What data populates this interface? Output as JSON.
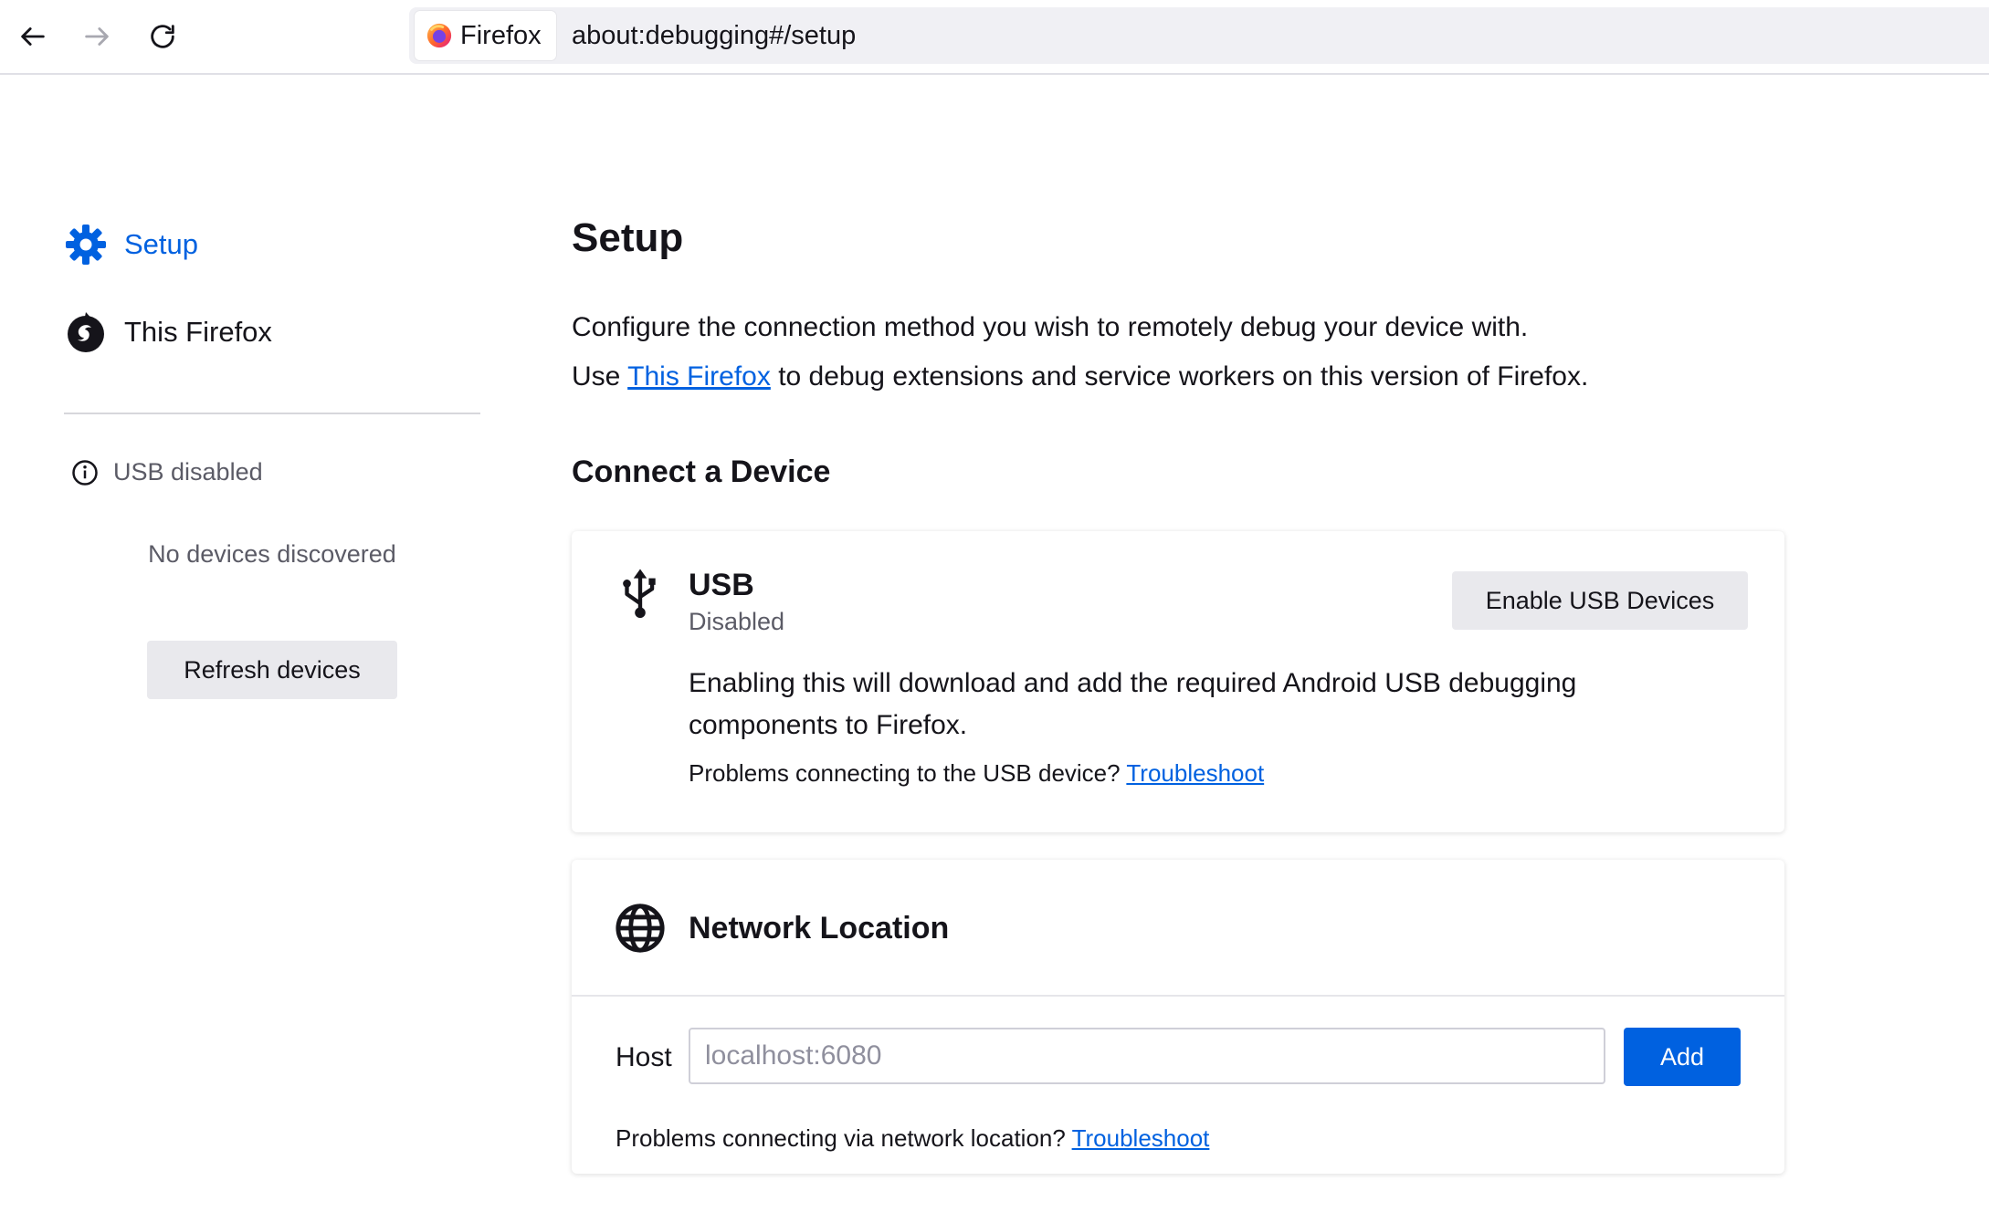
{
  "browser": {
    "identity_label": "Firefox",
    "url": "about:debugging#/setup",
    "icons": {
      "back": "arrow-left-icon",
      "forward": "arrow-right-icon",
      "reload": "reload-icon",
      "identity": "firefox-logo"
    }
  },
  "sidebar": {
    "items": [
      {
        "label": "Setup",
        "icon": "gear-icon",
        "selected": true
      },
      {
        "label": "This Firefox",
        "icon": "firefox-icon",
        "selected": false
      }
    ],
    "usb_status": "USB disabled",
    "no_devices": "No devices discovered",
    "refresh_label": "Refresh devices"
  },
  "main": {
    "title": "Setup",
    "intro": "Configure the connection method you wish to remotely debug your device with.",
    "use_prefix": "Use",
    "this_firefox_link": "This Firefox",
    "use_suffix": "to debug extensions and service workers on this version of Firefox.",
    "connect_title": "Connect a Device",
    "usb": {
      "title": "USB",
      "status": "Disabled",
      "enable_label": "Enable USB Devices",
      "description": "Enabling this will download and add the required Android USB debugging components to Firefox.",
      "help_text": "Problems connecting to the USB device?",
      "troubleshoot": "Troubleshoot"
    },
    "network": {
      "title": "Network Location",
      "host_label": "Host",
      "host_placeholder": "localhost:6080",
      "add_label": "Add",
      "help_text": "Problems connecting via network location?",
      "troubleshoot": "Troubleshoot"
    }
  },
  "colors": {
    "accent": "#0061e0",
    "button_bg": "#e9e9ed",
    "muted_text": "#5b5b66",
    "urlbar_bg": "#f0f0f4"
  }
}
